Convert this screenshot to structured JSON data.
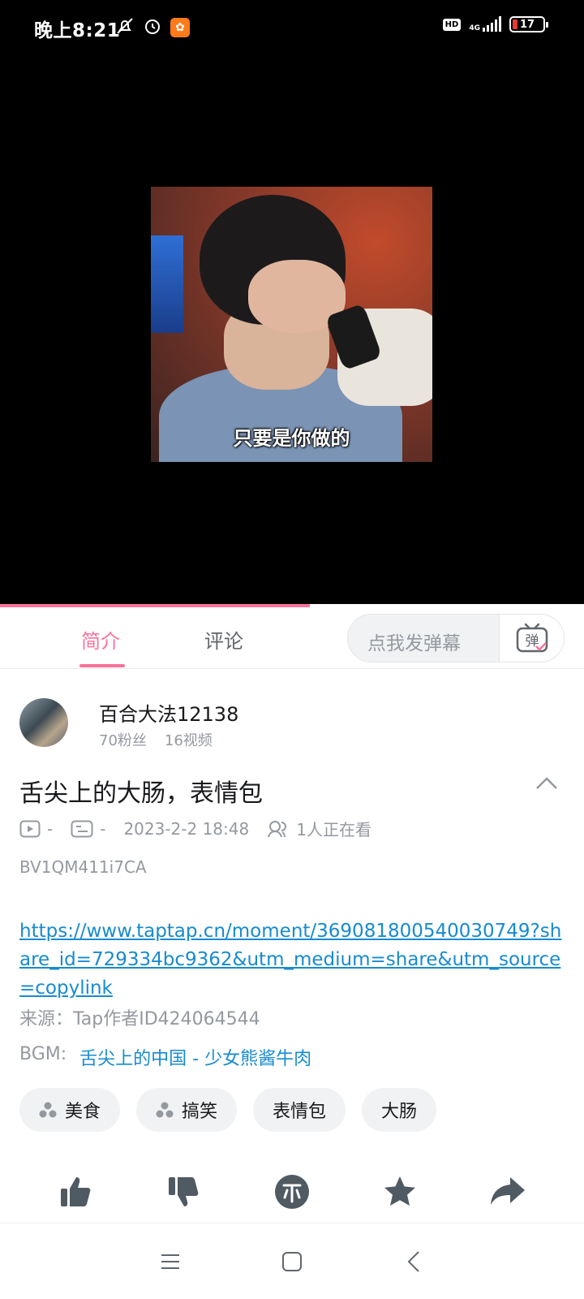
{
  "status_bar": {
    "time": "晚上8:21",
    "hd": "HD",
    "network": "4G",
    "battery": "17"
  },
  "video": {
    "subtitle": "只要是你做的",
    "progress_fraction": 0.53
  },
  "tabs": {
    "intro": "简介",
    "comments": "评论",
    "danmaku_placeholder": "点我发弹幕",
    "danmaku_button": "弹"
  },
  "uploader": {
    "name": "百合大法12138",
    "fans": "70粉丝",
    "videos": "16视频"
  },
  "video_info": {
    "title": "舌尖上的大肠，表情包",
    "plays": "-",
    "danmaku_count": "-",
    "date": "2023-2-2 18:48",
    "watching": "1人正在看",
    "bvid": "BV1QM411i7CA"
  },
  "description": {
    "link": "https://www.taptap.cn/moment/369081800540030749?share_id=729334bc9362&utm_medium=share&utm_source=copylink",
    "source": "来源：Tap作者ID424064544",
    "bgm_label": "BGM:",
    "bgm_value": "舌尖上的中国 - 少女熊酱牛肉"
  },
  "tags": [
    "美食",
    "搞笑",
    "表情包",
    "大肠"
  ],
  "colors": {
    "accent": "#fb7299",
    "link": "#178bcf",
    "muted": "#9499a0",
    "action_icon": "#505a63"
  },
  "icons": {
    "like": "thumbs-up-icon",
    "dislike": "thumbs-down-icon",
    "coin": "coin-icon",
    "favorite": "star-icon",
    "share": "share-arrow-icon"
  }
}
